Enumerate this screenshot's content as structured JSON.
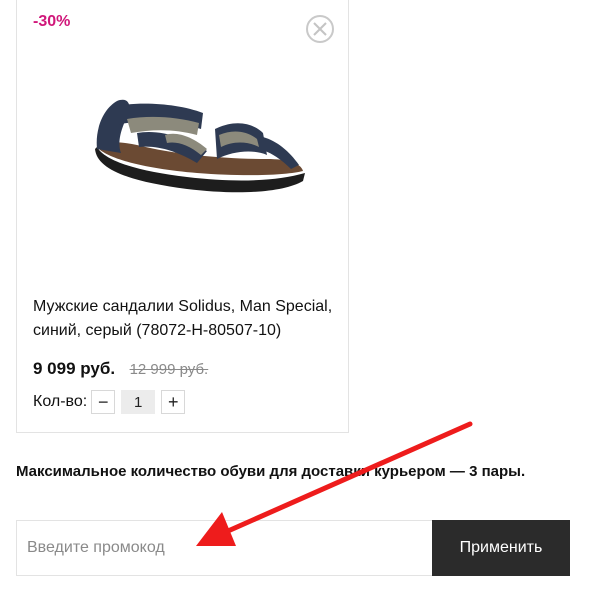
{
  "product": {
    "discount": "-30%",
    "name": "Мужские сандалии Solidus, Man Special, синий, серый (78072-H-80507-10)",
    "price_new": "9 099 руб.",
    "price_old": "12 999 руб.",
    "quantity_label": "Кол-во:",
    "quantity": "1",
    "minus": "−",
    "plus": "+"
  },
  "notice": "Максимальное количество обуви для доставки курьером — 3 пары.",
  "promo": {
    "placeholder": "Введите промокод",
    "value": "",
    "apply_label": "Применить"
  },
  "colors": {
    "discount": "#d0177a",
    "button_bg": "#2b2b2b",
    "arrow": "#ee1c1c"
  },
  "icons": {
    "remove": "close-circle-icon",
    "image": "sandal-product-image"
  }
}
